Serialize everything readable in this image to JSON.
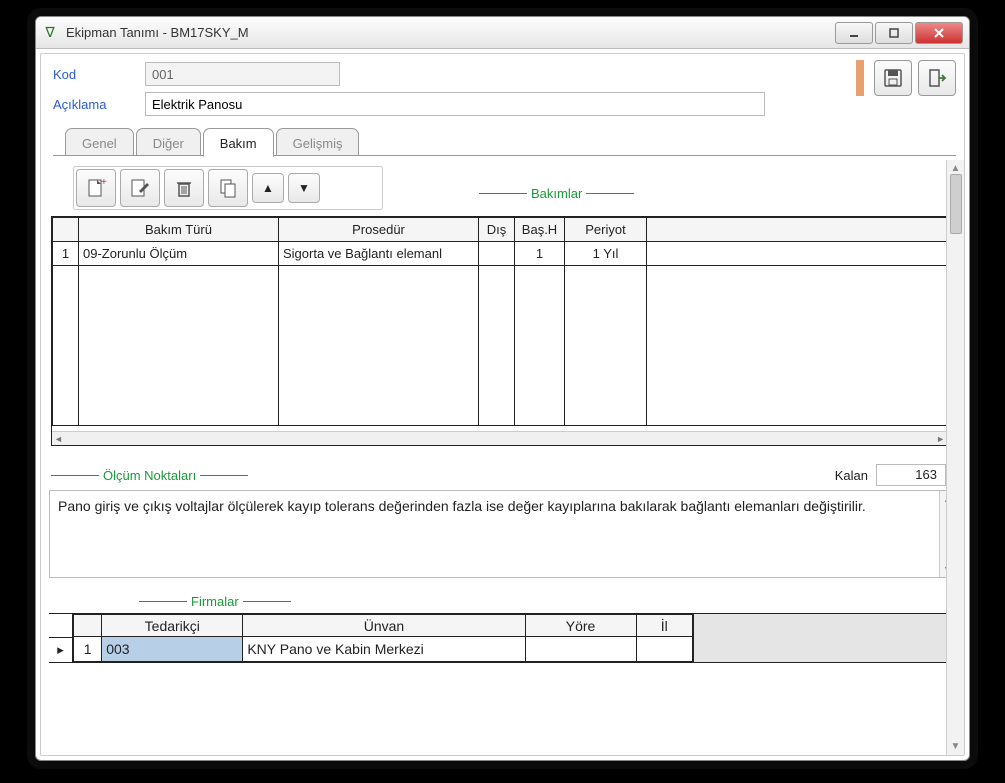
{
  "window": {
    "title": "Ekipman Tanımı - BM17SKY_M"
  },
  "form": {
    "kod_label": "Kod",
    "kod_value": "001",
    "aciklama_label": "Açıklama",
    "aciklama_value": "Elektrik Panosu"
  },
  "tabs": {
    "genel": "Genel",
    "diger": "Diğer",
    "bakim": "Bakım",
    "gelismis": "Gelişmiş"
  },
  "sections": {
    "bakimlar": "Bakımlar",
    "olcum": "Ölçüm Noktaları",
    "firmalar": "Firmalar"
  },
  "bakim_grid": {
    "headers": {
      "turu": "Bakım Türü",
      "prosedur": "Prosedür",
      "dis": "Dış",
      "bash": "Baş.H",
      "periyot": "Periyot"
    },
    "rows": [
      {
        "idx": "1",
        "turu": "09-Zorunlu Ölçüm",
        "prosedur": "Sigorta ve Bağlantı elemanl",
        "dis": "",
        "bash": "1",
        "periyot": "1 Yıl"
      }
    ]
  },
  "kalan": {
    "label": "Kalan",
    "value": "163"
  },
  "olcum_text": "Pano giriş ve çıkış voltajlar ölçülerek kayıp tolerans değerinden fazla ise değer kayıplarına bakılarak bağlantı elemanları değiştirilir.",
  "firma_grid": {
    "headers": {
      "tedarikci": "Tedarikçi",
      "unvan": "Ünvan",
      "yore": "Yöre",
      "il": "İl"
    },
    "rows": [
      {
        "idx": "1",
        "tedarikci": "003",
        "unvan": "KNY Pano ve Kabin Merkezi",
        "yore": "",
        "il": ""
      }
    ]
  },
  "icons": {
    "app": "∇",
    "save": "save",
    "exit": "exit",
    "new": "new",
    "edit": "edit",
    "delete": "delete",
    "copy": "copy",
    "up": "▲",
    "down": "▼"
  }
}
